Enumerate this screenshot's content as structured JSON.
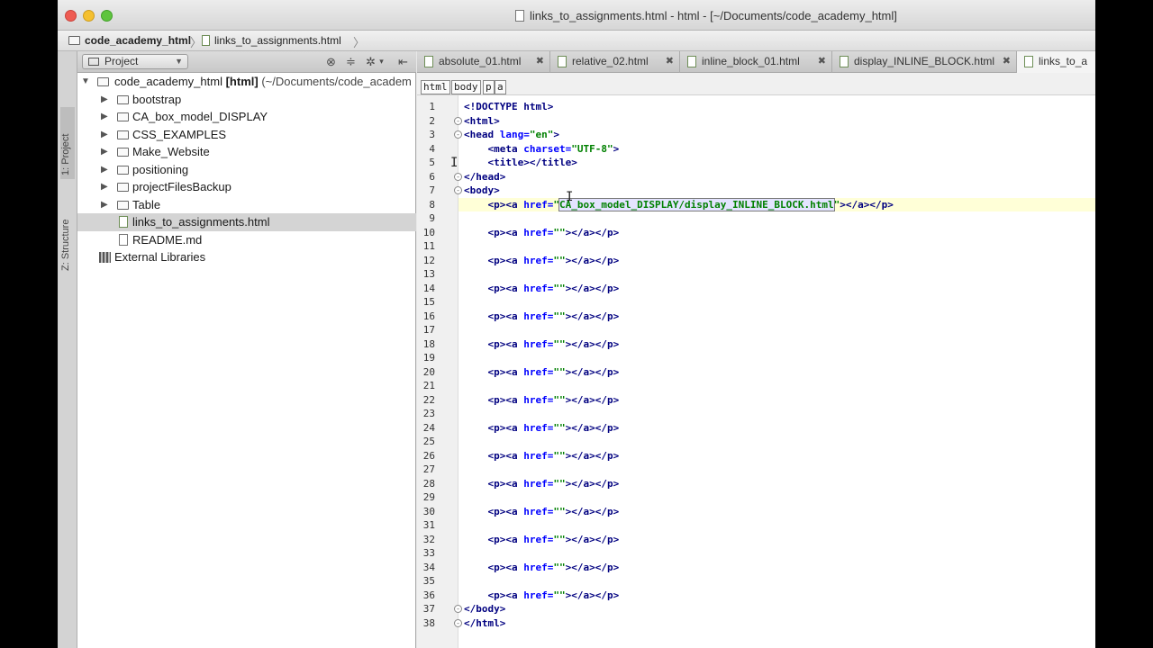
{
  "window": {
    "title": "links_to_assignments.html - html - [~/Documents/code_academy_html]"
  },
  "navbar": {
    "crumbs": [
      "code_academy_html",
      "links_to_assignments.html"
    ]
  },
  "toolstrip": {
    "project_tab": "1: Project",
    "structure_tab": "Z: Structure"
  },
  "project_panel": {
    "view_selector": "Project",
    "root": {
      "name": "code_academy_html",
      "module": "[html]",
      "path": "(~/Documents/code_academ"
    },
    "items": [
      {
        "label": "bootstrap",
        "type": "folder"
      },
      {
        "label": "CA_box_model_DISPLAY",
        "type": "folder"
      },
      {
        "label": "CSS_EXAMPLES",
        "type": "folder"
      },
      {
        "label": "Make_Website",
        "type": "folder"
      },
      {
        "label": "positioning",
        "type": "folder"
      },
      {
        "label": "projectFilesBackup",
        "type": "folder"
      },
      {
        "label": "Table",
        "type": "folder"
      },
      {
        "label": "links_to_assignments.html",
        "type": "file",
        "selected": true
      },
      {
        "label": "README.md",
        "type": "file"
      }
    ],
    "external": "External Libraries"
  },
  "tabs": [
    {
      "label": "absolute_01.html"
    },
    {
      "label": "relative_02.html"
    },
    {
      "label": "inline_block_01.html"
    },
    {
      "label": "display_INLINE_BLOCK.html"
    },
    {
      "label": "links_to_a",
      "active": true
    }
  ],
  "editor": {
    "tag_crumbs": [
      "html",
      "body",
      "p",
      "a"
    ],
    "current_line": 8,
    "lines": [
      {
        "n": "1",
        "segs": [
          {
            "c": "c-tag",
            "t": "<!DOCTYPE html>"
          }
        ]
      },
      {
        "n": "2",
        "segs": [
          {
            "c": "c-tag",
            "t": "<html>"
          }
        ]
      },
      {
        "n": "3",
        "segs": [
          {
            "c": "c-tag",
            "t": "<head "
          },
          {
            "c": "c-attr",
            "t": "lang="
          },
          {
            "c": "c-val",
            "t": "\"en\""
          },
          {
            "c": "c-tag",
            "t": ">"
          }
        ]
      },
      {
        "n": "4",
        "segs": [
          {
            "c": "c-tag",
            "t": "    <meta "
          },
          {
            "c": "c-attr",
            "t": "charset="
          },
          {
            "c": "c-val",
            "t": "\"UTF-8\""
          },
          {
            "c": "c-tag",
            "t": ">"
          }
        ]
      },
      {
        "n": "5",
        "segs": [
          {
            "c": "c-tag",
            "t": "    <title></title>"
          }
        ]
      },
      {
        "n": "6",
        "segs": [
          {
            "c": "c-tag",
            "t": "</head>"
          }
        ]
      },
      {
        "n": "7",
        "segs": [
          {
            "c": "c-tag",
            "t": "<body>"
          }
        ]
      },
      {
        "n": "8",
        "segs": [
          {
            "c": "c-tag",
            "t": "    <p><a "
          },
          {
            "c": "c-attr",
            "t": "href="
          },
          {
            "c": "c-val",
            "t": "\""
          },
          {
            "c": "c-hl",
            "t": "CA_box_model_DISPLAY/display_INLINE_BLOCK.html"
          },
          {
            "c": "c-val",
            "t": "\""
          },
          {
            "c": "c-tag",
            "t": "></a></p>"
          }
        ]
      },
      {
        "n": "9",
        "segs": []
      },
      {
        "n": "10",
        "segs": [
          {
            "c": "c-tag",
            "t": "    <p><a "
          },
          {
            "c": "c-attr",
            "t": "href="
          },
          {
            "c": "c-val",
            "t": "\"\""
          },
          {
            "c": "c-tag",
            "t": "></a></p>"
          }
        ]
      },
      {
        "n": "11",
        "segs": []
      },
      {
        "n": "12",
        "segs": [
          {
            "c": "c-tag",
            "t": "    <p><a "
          },
          {
            "c": "c-attr",
            "t": "href="
          },
          {
            "c": "c-val",
            "t": "\"\""
          },
          {
            "c": "c-tag",
            "t": "></a></p>"
          }
        ]
      },
      {
        "n": "13",
        "segs": []
      },
      {
        "n": "14",
        "segs": [
          {
            "c": "c-tag",
            "t": "    <p><a "
          },
          {
            "c": "c-attr",
            "t": "href="
          },
          {
            "c": "c-val",
            "t": "\"\""
          },
          {
            "c": "c-tag",
            "t": "></a></p>"
          }
        ]
      },
      {
        "n": "15",
        "segs": []
      },
      {
        "n": "16",
        "segs": [
          {
            "c": "c-tag",
            "t": "    <p><a "
          },
          {
            "c": "c-attr",
            "t": "href="
          },
          {
            "c": "c-val",
            "t": "\"\""
          },
          {
            "c": "c-tag",
            "t": "></a></p>"
          }
        ]
      },
      {
        "n": "17",
        "segs": []
      },
      {
        "n": "18",
        "segs": [
          {
            "c": "c-tag",
            "t": "    <p><a "
          },
          {
            "c": "c-attr",
            "t": "href="
          },
          {
            "c": "c-val",
            "t": "\"\""
          },
          {
            "c": "c-tag",
            "t": "></a></p>"
          }
        ]
      },
      {
        "n": "19",
        "segs": []
      },
      {
        "n": "20",
        "segs": [
          {
            "c": "c-tag",
            "t": "    <p><a "
          },
          {
            "c": "c-attr",
            "t": "href="
          },
          {
            "c": "c-val",
            "t": "\"\""
          },
          {
            "c": "c-tag",
            "t": "></a></p>"
          }
        ]
      },
      {
        "n": "21",
        "segs": []
      },
      {
        "n": "22",
        "segs": [
          {
            "c": "c-tag",
            "t": "    <p><a "
          },
          {
            "c": "c-attr",
            "t": "href="
          },
          {
            "c": "c-val",
            "t": "\"\""
          },
          {
            "c": "c-tag",
            "t": "></a></p>"
          }
        ]
      },
      {
        "n": "23",
        "segs": []
      },
      {
        "n": "24",
        "segs": [
          {
            "c": "c-tag",
            "t": "    <p><a "
          },
          {
            "c": "c-attr",
            "t": "href="
          },
          {
            "c": "c-val",
            "t": "\"\""
          },
          {
            "c": "c-tag",
            "t": "></a></p>"
          }
        ]
      },
      {
        "n": "25",
        "segs": []
      },
      {
        "n": "26",
        "segs": [
          {
            "c": "c-tag",
            "t": "    <p><a "
          },
          {
            "c": "c-attr",
            "t": "href="
          },
          {
            "c": "c-val",
            "t": "\"\""
          },
          {
            "c": "c-tag",
            "t": "></a></p>"
          }
        ]
      },
      {
        "n": "27",
        "segs": []
      },
      {
        "n": "28",
        "segs": [
          {
            "c": "c-tag",
            "t": "    <p><a "
          },
          {
            "c": "c-attr",
            "t": "href="
          },
          {
            "c": "c-val",
            "t": "\"\""
          },
          {
            "c": "c-tag",
            "t": "></a></p>"
          }
        ]
      },
      {
        "n": "29",
        "segs": []
      },
      {
        "n": "30",
        "segs": [
          {
            "c": "c-tag",
            "t": "    <p><a "
          },
          {
            "c": "c-attr",
            "t": "href="
          },
          {
            "c": "c-val",
            "t": "\"\""
          },
          {
            "c": "c-tag",
            "t": "></a></p>"
          }
        ]
      },
      {
        "n": "31",
        "segs": []
      },
      {
        "n": "32",
        "segs": [
          {
            "c": "c-tag",
            "t": "    <p><a "
          },
          {
            "c": "c-attr",
            "t": "href="
          },
          {
            "c": "c-val",
            "t": "\"\""
          },
          {
            "c": "c-tag",
            "t": "></a></p>"
          }
        ]
      },
      {
        "n": "33",
        "segs": []
      },
      {
        "n": "34",
        "segs": [
          {
            "c": "c-tag",
            "t": "    <p><a "
          },
          {
            "c": "c-attr",
            "t": "href="
          },
          {
            "c": "c-val",
            "t": "\"\""
          },
          {
            "c": "c-tag",
            "t": "></a></p>"
          }
        ]
      },
      {
        "n": "35",
        "segs": []
      },
      {
        "n": "36",
        "segs": [
          {
            "c": "c-tag",
            "t": "    <p><a "
          },
          {
            "c": "c-attr",
            "t": "href="
          },
          {
            "c": "c-val",
            "t": "\"\""
          },
          {
            "c": "c-tag",
            "t": "></a></p>"
          }
        ]
      },
      {
        "n": "37",
        "segs": [
          {
            "c": "c-tag",
            "t": "</body>"
          }
        ]
      },
      {
        "n": "38",
        "segs": [
          {
            "c": "c-tag",
            "t": "</html>"
          }
        ]
      }
    ]
  }
}
